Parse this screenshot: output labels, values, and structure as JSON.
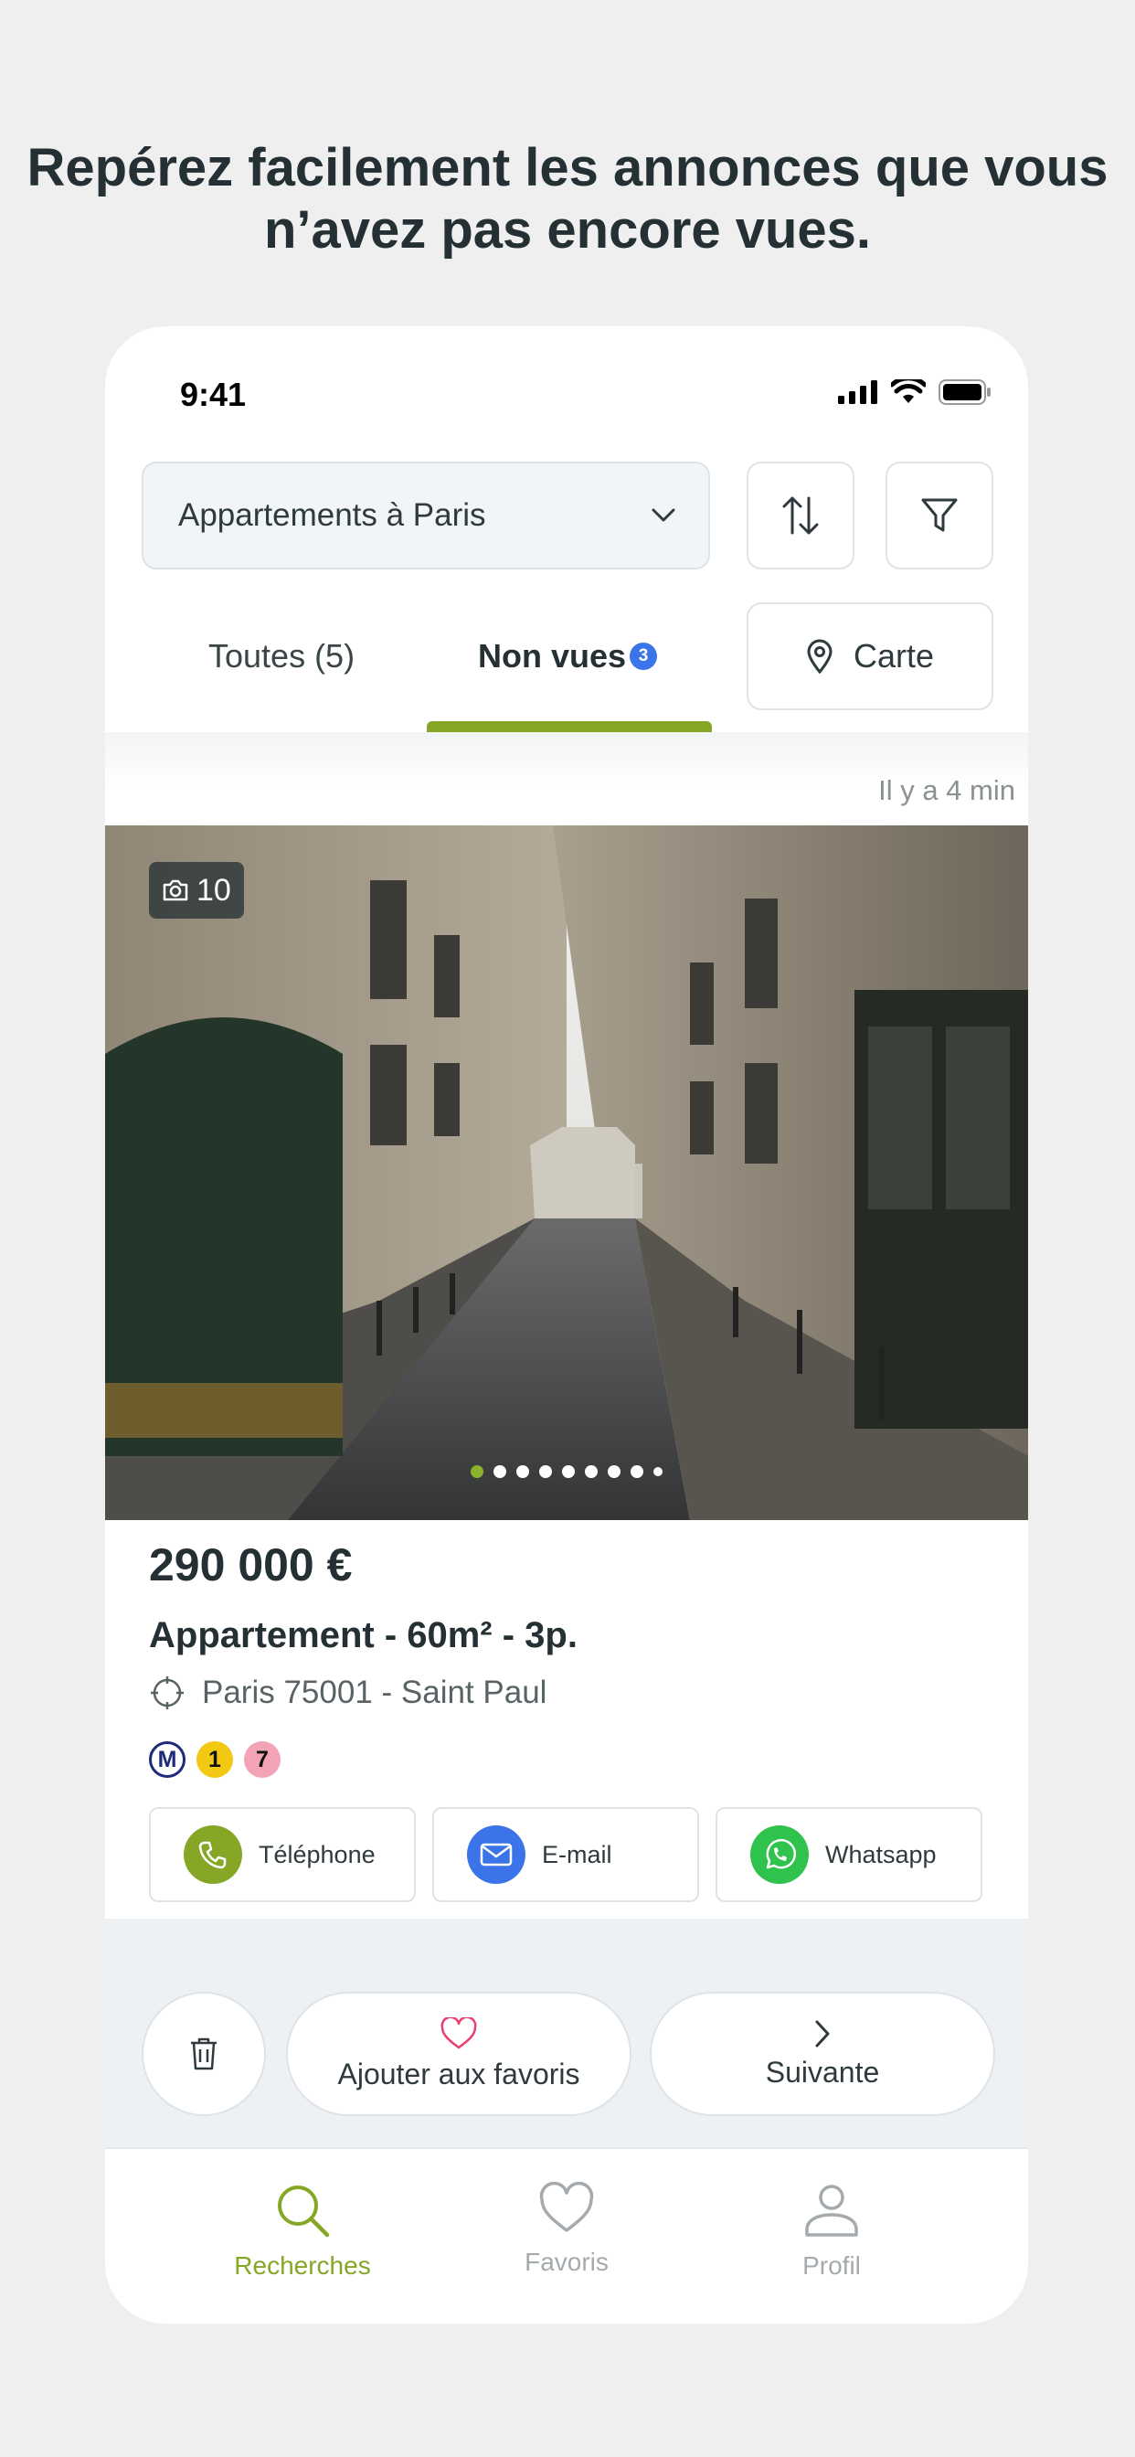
{
  "headline": "Repérez facilement les annonces que vous n’avez pas encore vues.",
  "status_bar": {
    "time": "9:41"
  },
  "search": {
    "selected": "Appartements à Paris"
  },
  "buttons": {
    "map": "Carte"
  },
  "tabs": [
    {
      "label": "Toutes (5)"
    },
    {
      "label": "Non vues",
      "badge": "3",
      "active": true
    }
  ],
  "listing": {
    "time_ago": "Il y a 4 min",
    "photo_count": "10",
    "photo_total_dots": 9,
    "price": "290 000 €",
    "title": "Appartement - 60m² - 3p.",
    "location": "Paris 75001 - Saint Paul",
    "metro": {
      "logo": "M",
      "lines": [
        "1",
        "7"
      ]
    },
    "contacts": [
      {
        "label": "Téléphone",
        "icon": "phone-icon",
        "color": "#86a725"
      },
      {
        "label": "E-mail",
        "icon": "mail-icon",
        "color": "#3b74e8"
      },
      {
        "label": "Whatsapp",
        "icon": "whatsapp-icon",
        "color": "#2fc24d"
      }
    ]
  },
  "actions": {
    "favorite": "Ajouter aux favoris",
    "next": "Suivante"
  },
  "bottom_nav": [
    {
      "label": "Recherches",
      "icon": "search-icon",
      "active": true
    },
    {
      "label": "Favoris",
      "icon": "heart-icon"
    },
    {
      "label": "Profil",
      "icon": "profile-icon"
    }
  ],
  "colors": {
    "accent": "#86a725",
    "badge": "#3b74e8",
    "text": "#243033"
  }
}
